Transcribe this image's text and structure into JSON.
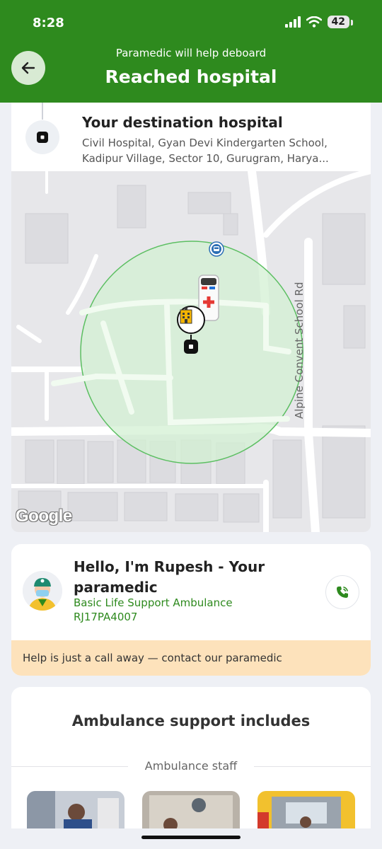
{
  "status_bar": {
    "time": "8:28",
    "battery": "42"
  },
  "header": {
    "subtitle": "Paramedic will help deboard",
    "title": "Reached hospital"
  },
  "destination": {
    "title": "Your destination hospital",
    "address": "Civil Hospital, Gyan Devi Kindergarten School, Kadipur Village, Sector 10, Gurugram, Harya..."
  },
  "map": {
    "road_label": "Alpine Convent School Rd",
    "logo_text": "Google"
  },
  "paramedic": {
    "name": "Hello, I'm Rupesh - Your paramedic",
    "ambulance_type": "Basic Life Support Ambulance",
    "plate": "RJ17PA4007",
    "help_text": "Help is just a call away — contact our paramedic"
  },
  "support": {
    "title": "Ambulance support includes",
    "section_label": "Ambulance staff"
  },
  "colors": {
    "brand_green": "#2e8a1e",
    "banner_bg": "#fde2bb",
    "geofence_fill": "#d3f0d3"
  }
}
